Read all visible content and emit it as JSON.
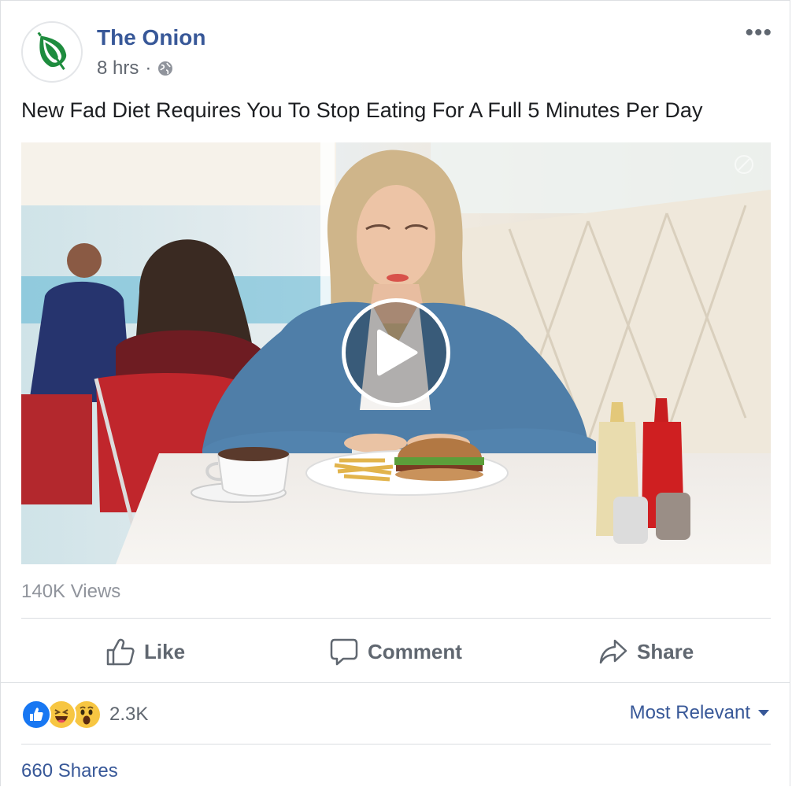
{
  "post": {
    "page_name": "The Onion",
    "timestamp": "8 hrs",
    "separator": "·",
    "privacy_icon": "globe-icon",
    "more_icon": "more-dots-icon",
    "more_label": "•••",
    "headline": "New Fad Diet Requires You To Stop Eating For A Full 5 Minutes Per Day",
    "avatar_icon": "onion-logo-icon",
    "brand_color": "#1e8c3e"
  },
  "video": {
    "play_icon": "play-icon",
    "watermark_icon": "onion-watermark-icon",
    "views": "140K Views"
  },
  "actions": {
    "like": {
      "label": "Like",
      "icon": "thumbs-up-icon"
    },
    "comment": {
      "label": "Comment",
      "icon": "speech-bubble-icon"
    },
    "share": {
      "label": "Share",
      "icon": "share-arrow-icon"
    }
  },
  "reactions": {
    "icons": [
      "like-reaction-icon",
      "haha-reaction-icon",
      "wow-reaction-icon"
    ],
    "count": "2.3K",
    "sort_label": "Most Relevant",
    "sort_icon": "caret-down-icon"
  },
  "shares": {
    "label": "660 Shares"
  },
  "colors": {
    "link_blue": "#385898",
    "text_gray": "#606770",
    "like_blue": "#1877f2",
    "emoji_yellow": "#f7c642"
  }
}
